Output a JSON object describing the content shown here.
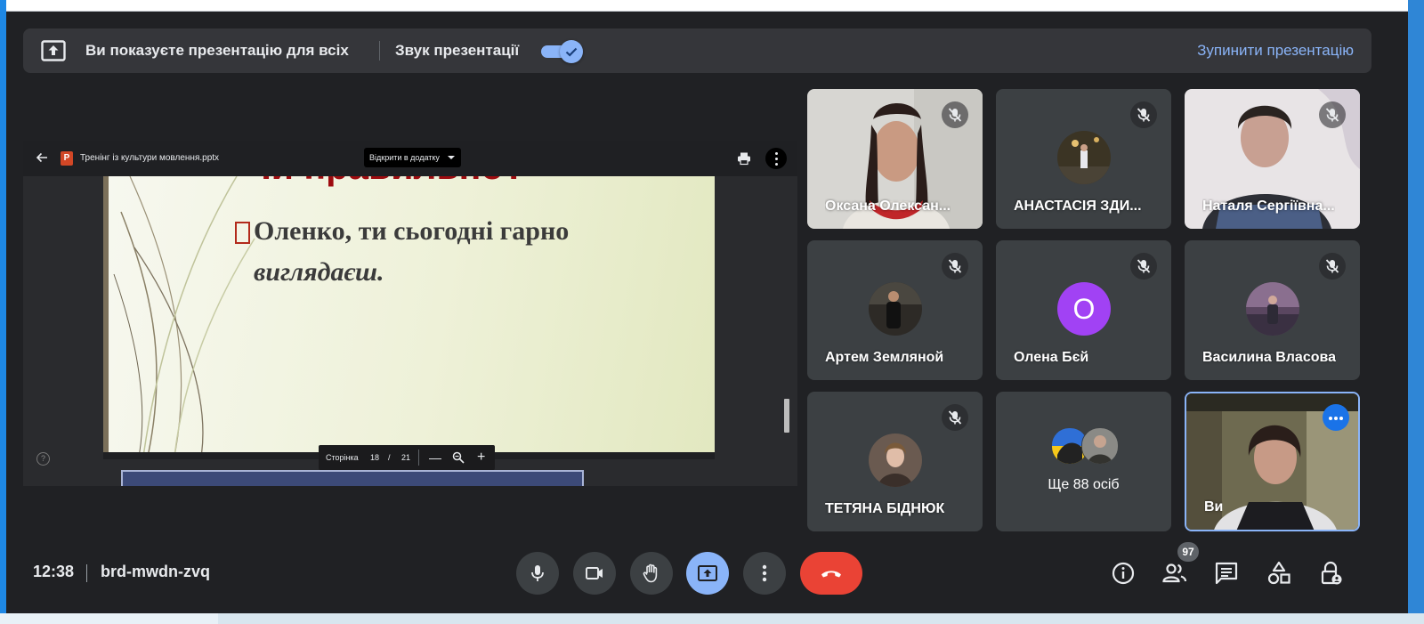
{
  "banner": {
    "title": "Ви показуєте презентацію для всіх",
    "audio_label": "Звук презентації",
    "audio_on": true,
    "stop_label": "Зупинити презентацію",
    "accent": "#8ab4f8"
  },
  "viewer": {
    "file_name": "Тренінг із культури мовлення.pptx",
    "open_with": "Відкрити в додатку",
    "page_label": "Сторінка",
    "page_current": "18",
    "page_sep": "/",
    "page_total": "21"
  },
  "slide": {
    "title": "Чи правильно?",
    "line1": "Оленко, ти сьогодні гарно",
    "line2": "виглядаєш."
  },
  "participants": [
    {
      "name": "Оксана Олексан...",
      "muted": true
    },
    {
      "name": "АНАСТАСІЯ ЗДИ...",
      "muted": true
    },
    {
      "name": "Наталя Сергіївна...",
      "muted": true
    },
    {
      "name": "Артем Земляной",
      "muted": true
    },
    {
      "name": "Олена Бєй",
      "muted": true,
      "initial": "О"
    },
    {
      "name": "Василина Власова",
      "muted": true
    },
    {
      "name": "ТЕТЯНА БІДНЮК",
      "muted": true
    },
    {
      "name": "",
      "more_label": "Ще 88 осіб"
    },
    {
      "name": "Ви"
    }
  ],
  "bottom": {
    "time": "12:38",
    "meeting_code": "brd-mwdn-zvq",
    "people_count": "97"
  },
  "icons": {
    "present": "present-screen-icon",
    "mic": "microphone-icon",
    "camera": "camera-icon",
    "hand": "raise-hand-icon",
    "more": "more-vertical-icon",
    "leave": "hang-up-icon",
    "info": "info-icon",
    "people": "people-icon",
    "chat": "chat-icon",
    "activities": "activities-icon",
    "host": "host-controls-icon"
  }
}
